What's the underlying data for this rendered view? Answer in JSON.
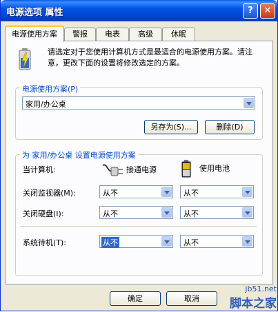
{
  "window": {
    "title": "电源选项 属性",
    "help_glyph": "?",
    "close_glyph": "✕"
  },
  "tabs": [
    {
      "label": "电源使用方案",
      "active": true
    },
    {
      "label": "警报",
      "active": false
    },
    {
      "label": "电表",
      "active": false
    },
    {
      "label": "高级",
      "active": false
    },
    {
      "label": "休眠",
      "active": false
    }
  ],
  "description": "请选定对于您使用计算机方式是最适合的电源使用方案。请注意，更改下面的设置将修改选定的方案。",
  "scheme_group": {
    "label": "电源使用方案(P)",
    "selected": "家用/办公桌",
    "save_as_label": "另存为(S)...",
    "delete_label": "删除(D)"
  },
  "settings_group": {
    "label": "为 家用/办公桌 设置电源使用方案",
    "when_computer_label": "当计算机:",
    "plugged_in_label": "接通电源",
    "battery_label": "使用电池",
    "rows": [
      {
        "label": "关闭监视器(M):",
        "ac": "从不",
        "dc": "从不"
      },
      {
        "label": "关闭硬盘(I):",
        "ac": "从不",
        "dc": "从不"
      },
      {
        "label": "系统待机(T):",
        "ac": "从不",
        "dc": "从不"
      }
    ]
  },
  "footer": {
    "ok_label": "确定",
    "cancel_label": "取消"
  },
  "watermark": {
    "site": "jb51.net",
    "name": "脚本之家"
  },
  "colors": {
    "title_bar": "#0055e5",
    "group_label": "#0046d5",
    "tab_highlight": "#ffc83c",
    "selection": "#316ac5"
  }
}
